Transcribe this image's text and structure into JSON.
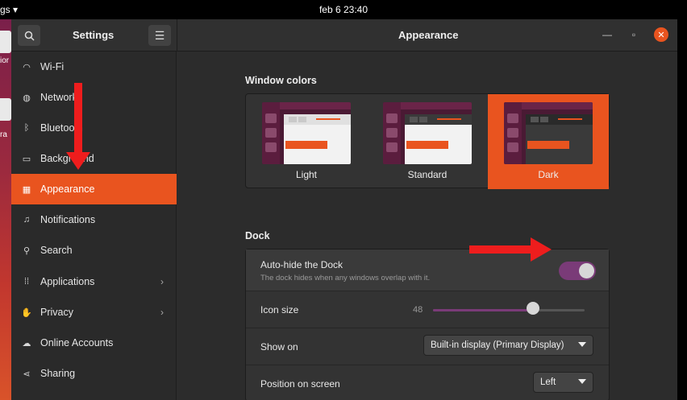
{
  "topbar": {
    "activities_fragment": "gs ▾",
    "clock": "feb 6  23:40"
  },
  "desktop": {
    "text1": "ior",
    "text2": "ra"
  },
  "sidebar": {
    "title": "Settings",
    "items": [
      {
        "label": "Wi-Fi",
        "icon": "wifi-icon"
      },
      {
        "label": "Network",
        "icon": "network-icon"
      },
      {
        "label": "Bluetooth",
        "icon": "bluetooth-icon"
      },
      {
        "label": "Background",
        "icon": "background-icon"
      },
      {
        "label": "Appearance",
        "icon": "appearance-icon",
        "active": true
      },
      {
        "label": "Notifications",
        "icon": "bell-icon"
      },
      {
        "label": "Search",
        "icon": "search-icon"
      },
      {
        "label": "Applications",
        "icon": "apps-grid-icon",
        "chevron": true
      },
      {
        "label": "Privacy",
        "icon": "hand-icon",
        "chevron": true
      },
      {
        "label": "Online Accounts",
        "icon": "cloud-icon"
      },
      {
        "label": "Sharing",
        "icon": "share-icon"
      }
    ]
  },
  "main": {
    "title": "Appearance",
    "window_colors": {
      "heading": "Window colors",
      "options": [
        {
          "label": "Light",
          "selected": false
        },
        {
          "label": "Standard",
          "selected": false
        },
        {
          "label": "Dark",
          "selected": true
        }
      ]
    },
    "dock": {
      "heading": "Dock",
      "autohide": {
        "label": "Auto-hide the Dock",
        "sub": "The dock hides when any windows overlap with it.",
        "on": true
      },
      "icon_size": {
        "label": "Icon size",
        "value": "48",
        "fraction": 0.66
      },
      "show_on": {
        "label": "Show on",
        "value": "Built-in display (Primary Display)"
      },
      "position": {
        "label": "Position on screen",
        "value": "Left"
      }
    }
  },
  "colors": {
    "accent": "#e9541f",
    "toggle_on": "#7a3b78",
    "annotation": "#ee1d1d"
  }
}
